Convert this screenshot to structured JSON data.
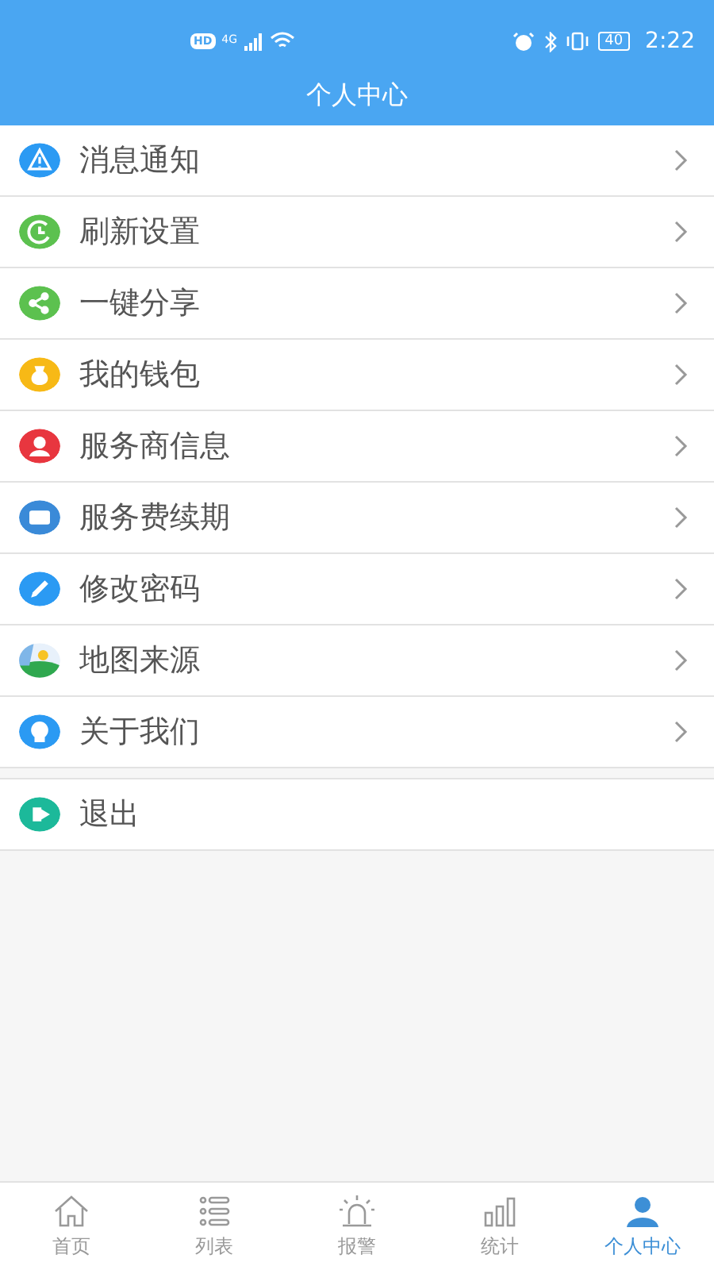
{
  "status_bar": {
    "hd": "HD",
    "network": "4G",
    "battery": "40",
    "time": "2:22"
  },
  "header": {
    "title": "个人中心"
  },
  "menu": [
    {
      "label": "消息通知",
      "color": "#2b9af3"
    },
    {
      "label": "刷新设置",
      "color": "#5cc14f"
    },
    {
      "label": "一键分享",
      "color": "#5cc14f"
    },
    {
      "label": "我的钱包",
      "color": "#f7b916"
    },
    {
      "label": "服务商信息",
      "color": "#e8363f"
    },
    {
      "label": "服务费续期",
      "color": "#3a8ad8"
    },
    {
      "label": "修改密码",
      "color": "#2b9af3"
    },
    {
      "label": "地图来源",
      "color": "#2fa84f"
    },
    {
      "label": "关于我们",
      "color": "#2b9af3"
    }
  ],
  "exit": {
    "label": "退出",
    "color": "#1cb99a"
  },
  "tabs": [
    {
      "label": "首页",
      "selected": false
    },
    {
      "label": "列表",
      "selected": false
    },
    {
      "label": "报警",
      "selected": false
    },
    {
      "label": "统计",
      "selected": false
    },
    {
      "label": "个人中心",
      "selected": true
    }
  ]
}
